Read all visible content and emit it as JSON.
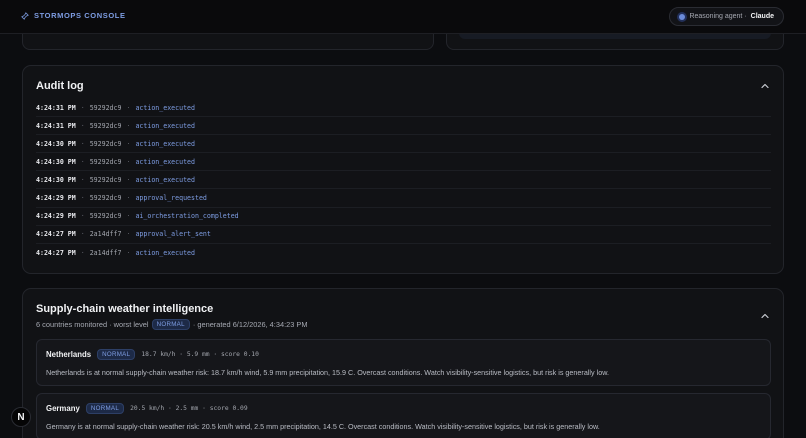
{
  "app": {
    "title": "STORMOPS CONSOLE"
  },
  "agent": {
    "status_label": "Reasoning agent ·",
    "name": "Claude"
  },
  "audit": {
    "title": "Audit log",
    "entries": [
      {
        "time": "4:24:31 PM",
        "id": "59292dc9",
        "action": "action_executed"
      },
      {
        "time": "4:24:31 PM",
        "id": "59292dc9",
        "action": "action_executed"
      },
      {
        "time": "4:24:30 PM",
        "id": "59292dc9",
        "action": "action_executed"
      },
      {
        "time": "4:24:30 PM",
        "id": "59292dc9",
        "action": "action_executed"
      },
      {
        "time": "4:24:30 PM",
        "id": "59292dc9",
        "action": "action_executed"
      },
      {
        "time": "4:24:29 PM",
        "id": "59292dc9",
        "action": "approval_requested"
      },
      {
        "time": "4:24:29 PM",
        "id": "59292dc9",
        "action": "ai_orchestration_completed"
      },
      {
        "time": "4:24:27 PM",
        "id": "2a14dff7",
        "action": "approval_alert_sent"
      },
      {
        "time": "4:24:27 PM",
        "id": "2a14dff7",
        "action": "action_executed"
      }
    ]
  },
  "supply": {
    "title": "Supply-chain weather intelligence",
    "countries_monitored": "6 countries monitored · worst level",
    "worst_level": "NORMAL",
    "generated": "· generated 6/12/2026, 4:34:23 PM",
    "countries": [
      {
        "name": "Netherlands",
        "level": "NORMAL",
        "metrics": "18.7 km/h · 5.9 mm · score 0.10",
        "description": "Netherlands is at normal supply-chain weather risk: 18.7 km/h wind, 5.9 mm precipitation, 15.9 C. Overcast conditions. Watch visibility-sensitive logistics, but risk is generally low."
      },
      {
        "name": "Germany",
        "level": "NORMAL",
        "metrics": "20.5 km/h · 2.5 mm · score 0.09",
        "description": "Germany is at normal supply-chain weather risk: 20.5 km/h wind, 2.5 mm precipitation, 14.5 C. Overcast conditions. Watch visibility-sensitive logistics, but risk is generally low."
      }
    ]
  },
  "dev": {
    "indicator": "N"
  },
  "icons": {
    "brand": "pin-icon",
    "collapse": "chevron-up-icon"
  },
  "colors": {
    "accent": "#7e9de3",
    "background": "#0c0d10",
    "card": "#111215"
  }
}
